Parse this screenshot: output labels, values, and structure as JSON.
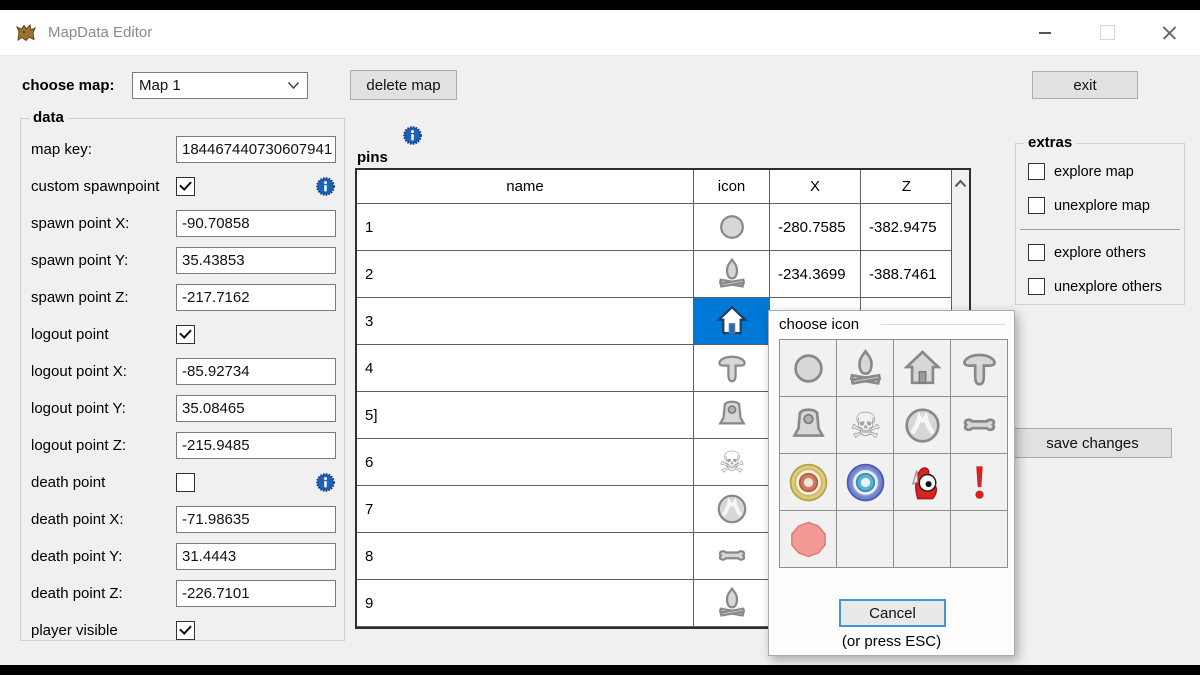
{
  "window": {
    "title": "MapData Editor"
  },
  "toolbar": {
    "choose_map_label": "choose map:",
    "selected_map": "Map 1",
    "delete_map_label": "delete map",
    "exit_label": "exit"
  },
  "data_panel": {
    "title": "data",
    "rows": [
      {
        "label": "map key:",
        "type": "text",
        "value": "184467440730607941",
        "info": false
      },
      {
        "label": "custom spawnpoint",
        "type": "checkbox",
        "checked": true,
        "info": true
      },
      {
        "label": "spawn point X:",
        "type": "text",
        "value": "-90.70858",
        "info": false
      },
      {
        "label": "spawn point Y:",
        "type": "text",
        "value": "35.43853",
        "info": false
      },
      {
        "label": "spawn point Z:",
        "type": "text",
        "value": "-217.7162",
        "info": false
      },
      {
        "label": "logout point",
        "type": "checkbox",
        "checked": true,
        "info": false
      },
      {
        "label": "logout point X:",
        "type": "text",
        "value": "-85.92734",
        "info": false
      },
      {
        "label": "logout point Y:",
        "type": "text",
        "value": "35.08465",
        "info": false
      },
      {
        "label": "logout point Z:",
        "type": "text",
        "value": "-215.9485",
        "info": false
      },
      {
        "label": "death point",
        "type": "checkbox",
        "checked": false,
        "info": true
      },
      {
        "label": "death point X:",
        "type": "text",
        "value": "-71.98635",
        "info": false
      },
      {
        "label": "death point Y:",
        "type": "text",
        "value": "31.4443",
        "info": false
      },
      {
        "label": "death point Z:",
        "type": "text",
        "value": "-226.7101",
        "info": false
      },
      {
        "label": "player visible",
        "type": "checkbox",
        "checked": true,
        "info": false
      }
    ]
  },
  "pins": {
    "title": "pins",
    "columns": [
      "name",
      "icon",
      "X",
      "Z"
    ],
    "rows": [
      {
        "name": "1",
        "icon": "circle-pin",
        "x": "-280.7585",
        "z": "-382.9475",
        "selected": false
      },
      {
        "name": "2",
        "icon": "campfire",
        "x": "-234.3699",
        "z": "-388.7461",
        "selected": false
      },
      {
        "name": "3",
        "icon": "house",
        "x": "",
        "z": "",
        "selected": true
      },
      {
        "name": "4",
        "icon": "mushroom",
        "x": "",
        "z": "",
        "selected": false
      },
      {
        "name": "5]",
        "icon": "gravestone",
        "x": "",
        "z": "",
        "selected": false
      },
      {
        "name": "6",
        "icon": "skull-crossbones",
        "x": "",
        "z": "",
        "selected": false
      },
      {
        "name": "7",
        "icon": "claw-orb",
        "x": "",
        "z": "",
        "selected": false
      },
      {
        "name": "8",
        "icon": "bone",
        "x": "",
        "z": "",
        "selected": false
      },
      {
        "name": "9",
        "icon": "campfire",
        "x": "",
        "z": "",
        "selected": false
      }
    ]
  },
  "icon_picker": {
    "title": "choose icon",
    "icons": [
      "circle-pin",
      "campfire",
      "house",
      "mushroom",
      "gravestone",
      "skull-crossbones",
      "claw-orb",
      "bone",
      "target-gold",
      "target-blue",
      "red-creature",
      "exclamation-mark",
      "pink-circle",
      "",
      "",
      ""
    ],
    "cancel_label": "Cancel",
    "hint": "(or press ESC)"
  },
  "extras": {
    "title": "extras",
    "items": [
      {
        "label": "explore map",
        "checked": false,
        "divider_after": false
      },
      {
        "label": "unexplore map",
        "checked": false,
        "divider_after": true
      },
      {
        "label": "explore others",
        "checked": false,
        "divider_after": false
      },
      {
        "label": "unexplore others",
        "checked": false,
        "divider_after": false
      }
    ],
    "save_label": "save changes"
  },
  "colors": {
    "selection_blue": "#0078d7",
    "info_blue": "#1d62b8",
    "exclamation_red": "#d92020",
    "pink_pin": "#f29a93",
    "target_gold": "#decb7e",
    "target_blue": "#7482cc"
  }
}
